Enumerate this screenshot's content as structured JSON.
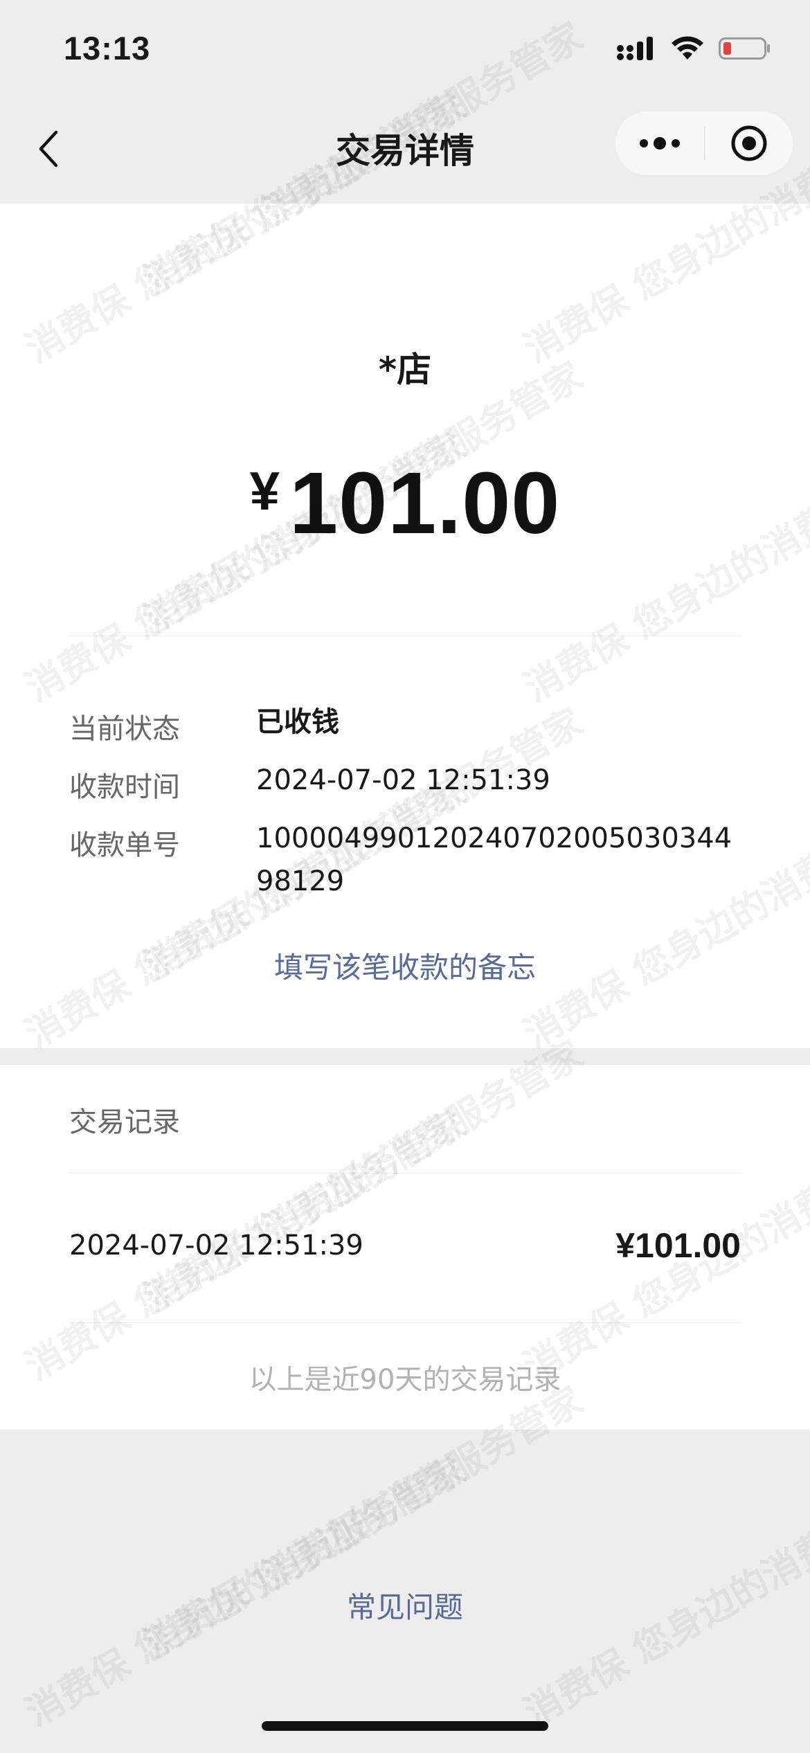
{
  "status_bar": {
    "time": "13:13",
    "icons": [
      "signal-icon",
      "wifi-icon",
      "battery-icon"
    ],
    "battery_color": "#e64340"
  },
  "nav": {
    "title": "交易详情",
    "back_icon": "chevron-left-icon",
    "more_icon": "more-dots-icon",
    "close_icon": "target-close-icon"
  },
  "transaction": {
    "merchant": "*店",
    "currency_symbol": "¥",
    "amount": "101.00",
    "fields": [
      {
        "label": "当前状态",
        "value": "已收钱"
      },
      {
        "label": "收款时间",
        "value": "2024-07-02 12:51:39"
      },
      {
        "label": "收款单号",
        "value": "100004990120240702005030344 98129"
      }
    ],
    "memo_link": "填写该笔收款的备忘"
  },
  "records": {
    "title": "交易记录",
    "items": [
      {
        "time": "2024-07-02 12:51:39",
        "amount": "¥101.00"
      }
    ],
    "note": "以上是近90天的交易记录"
  },
  "footer": {
    "faq_link": "常见问题"
  },
  "watermark_text": "消费保 您身边的消费服务管家",
  "colors": {
    "link": "#576b95",
    "background": "#ededed",
    "card": "#ffffff"
  }
}
